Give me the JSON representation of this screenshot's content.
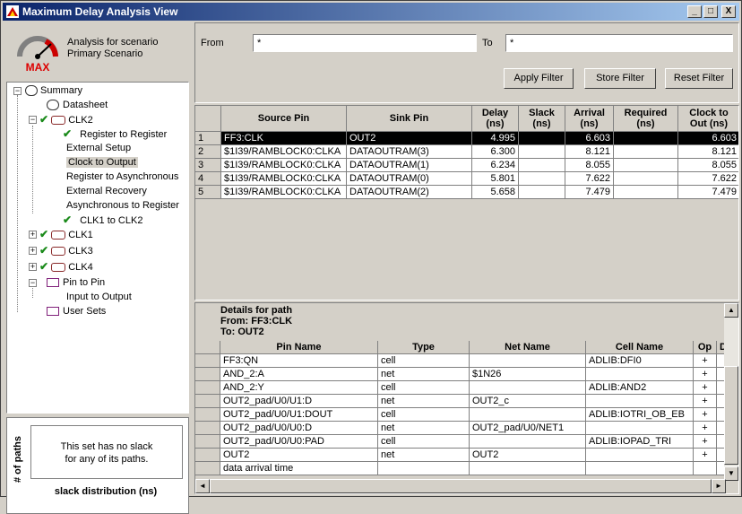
{
  "window": {
    "title": "Maximum Delay Analysis View",
    "min": "_",
    "max": "□",
    "close": "X"
  },
  "scenario": {
    "line1": "Analysis for scenario",
    "line2": "Primary Scenario",
    "gauge_label": "MAX"
  },
  "tree": {
    "summary": "Summary",
    "datasheet": "Datasheet",
    "clk2": "CLK2",
    "reg_to_reg": "Register to Register",
    "ext_setup": "External Setup",
    "clk_to_out": "Clock to Output",
    "reg_to_async": "Register to Asynchronous",
    "ext_recovery": "External Recovery",
    "async_to_reg": "Asynchronous to Register",
    "clk1_to_clk2": "CLK1 to CLK2",
    "clk1": "CLK1",
    "clk3": "CLK3",
    "clk4": "CLK4",
    "pin_to_pin": "Pin to Pin",
    "input_to_output": "Input to Output",
    "user_sets": "User Sets"
  },
  "slack": {
    "vertical_label": "# of paths",
    "message_line1": "This set has no slack",
    "message_line2": "for any of its paths.",
    "caption": "slack distribution (ns)"
  },
  "filter": {
    "from_label": "From",
    "from_value": "*",
    "to_label": "To",
    "to_value": "*",
    "apply": "Apply Filter",
    "store": "Store Filter",
    "reset": "Reset Filter"
  },
  "paths_table": {
    "headers": {
      "source": "Source Pin",
      "sink": "Sink Pin",
      "delay": "Delay\n(ns)",
      "slack": "Slack\n(ns)",
      "arrival": "Arrival\n(ns)",
      "required": "Required\n(ns)",
      "clock_out": "Clock to\nOut (ns)"
    },
    "rows": [
      {
        "n": "1",
        "source": "FF3:CLK",
        "sink": "OUT2",
        "delay": "4.995",
        "slack": "",
        "arrival": "6.603",
        "required": "",
        "clock_out": "6.603"
      },
      {
        "n": "2",
        "source": "$1I39/RAMBLOCK0:CLKA",
        "sink": "DATAOUTRAM(3)",
        "delay": "6.300",
        "slack": "",
        "arrival": "8.121",
        "required": "",
        "clock_out": "8.121"
      },
      {
        "n": "3",
        "source": "$1I39/RAMBLOCK0:CLKA",
        "sink": "DATAOUTRAM(1)",
        "delay": "6.234",
        "slack": "",
        "arrival": "8.055",
        "required": "",
        "clock_out": "8.055"
      },
      {
        "n": "4",
        "source": "$1I39/RAMBLOCK0:CLKA",
        "sink": "DATAOUTRAM(0)",
        "delay": "5.801",
        "slack": "",
        "arrival": "7.622",
        "required": "",
        "clock_out": "7.622"
      },
      {
        "n": "5",
        "source": "$1I39/RAMBLOCK0:CLKA",
        "sink": "DATAOUTRAM(2)",
        "delay": "5.658",
        "slack": "",
        "arrival": "7.479",
        "required": "",
        "clock_out": "7.479"
      }
    ]
  },
  "details": {
    "title": "Details for path",
    "from": "From: FF3:CLK",
    "to": "To: OUT2",
    "headers": {
      "pin": "Pin Name",
      "type": "Type",
      "net": "Net Name",
      "cell": "Cell Name",
      "op": "Op",
      "extra": "D"
    },
    "rows": [
      {
        "pin": "FF3:QN",
        "type": "cell",
        "net": "",
        "cell": "ADLIB:DFI0",
        "op": "+"
      },
      {
        "pin": "AND_2:A",
        "type": "net",
        "net": "$1N26",
        "cell": "",
        "op": "+"
      },
      {
        "pin": "AND_2:Y",
        "type": "cell",
        "net": "",
        "cell": "ADLIB:AND2",
        "op": "+"
      },
      {
        "pin": "OUT2_pad/U0/U1:D",
        "type": "net",
        "net": "OUT2_c",
        "cell": "",
        "op": "+"
      },
      {
        "pin": "OUT2_pad/U0/U1:DOUT",
        "type": "cell",
        "net": "",
        "cell": "ADLIB:IOTRI_OB_EB",
        "op": "+"
      },
      {
        "pin": "OUT2_pad/U0/U0:D",
        "type": "net",
        "net": "OUT2_pad/U0/NET1",
        "cell": "",
        "op": "+"
      },
      {
        "pin": "OUT2_pad/U0/U0:PAD",
        "type": "cell",
        "net": "",
        "cell": "ADLIB:IOPAD_TRI",
        "op": "+"
      },
      {
        "pin": "OUT2",
        "type": "net",
        "net": "OUT2",
        "cell": "",
        "op": "+"
      },
      {
        "pin": "data arrival time",
        "type": "",
        "net": "",
        "cell": "",
        "op": ""
      }
    ]
  }
}
